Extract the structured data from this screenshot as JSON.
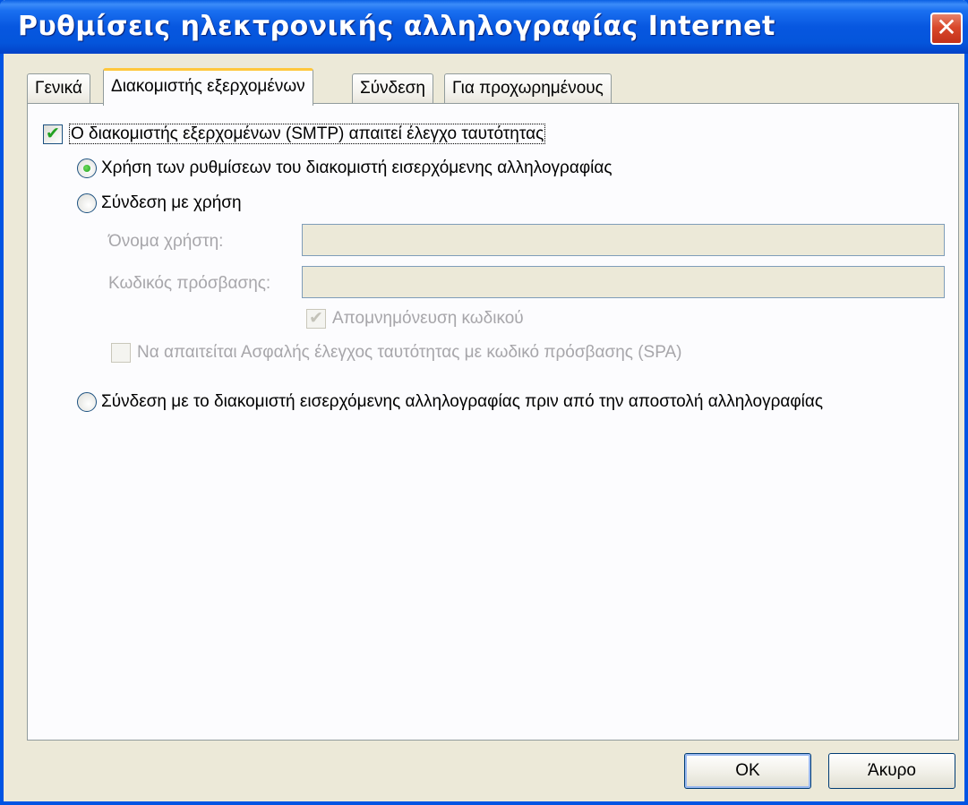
{
  "window": {
    "title": "Ρυθμίσεις ηλεκτρονικής αλληλογραφίας Internet",
    "close_glyph": "✕"
  },
  "tabs": [
    {
      "label": "Γενικά"
    },
    {
      "label": "Διακομιστής εξερχομένων"
    },
    {
      "label": "Σύνδεση"
    },
    {
      "label": "Για προχωρημένους"
    }
  ],
  "panel": {
    "smtp_auth": {
      "label": "Ο διακομιστής εξερχομένων (SMTP) απαιτεί έλεγχο ταυτότητας",
      "checked": true
    },
    "use_incoming_settings": {
      "label": "Χρήση των ρυθμίσεων του διακομιστή εισερχόμενης αλληλογραφίας",
      "selected": true
    },
    "login_using": {
      "label": "Σύνδεση με χρήση",
      "selected": false
    },
    "username": {
      "label": "Όνομα χρήστη:",
      "value": ""
    },
    "password": {
      "label": "Κωδικός πρόσβασης:",
      "value": ""
    },
    "remember_password": {
      "label": "Απομνημόνευση κωδικού",
      "checked": true,
      "disabled": true
    },
    "spa": {
      "label": "Να απαιτείται Ασφαλής έλεγχος ταυτότητας με κωδικό πρόσβασης (SPA)",
      "checked": false,
      "disabled": true
    },
    "login_before_send": {
      "label": "Σύνδεση με το διακομιστή εισερχόμενης αλληλογραφίας πριν από την αποστολή αλληλογραφίας",
      "selected": false
    }
  },
  "buttons": {
    "ok": "OK",
    "cancel": "Άκυρο"
  },
  "colors": {
    "titlebar": "#0757e0",
    "dialog_bg": "#ece9d8",
    "active_tab_accent": "#ffc73c",
    "check_green": "#21a121"
  }
}
